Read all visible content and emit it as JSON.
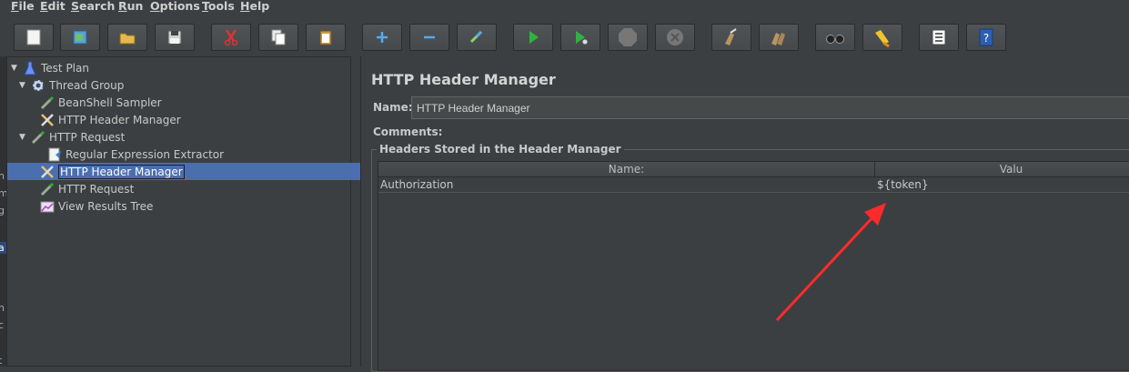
{
  "menu": {
    "items": [
      {
        "u": "F",
        "rest": "ile"
      },
      {
        "u": "E",
        "rest": "dit"
      },
      {
        "u": "S",
        "rest": "earch"
      },
      {
        "u": "R",
        "rest": "un"
      },
      {
        "u": "O",
        "rest": "ptions"
      },
      {
        "u": "T",
        "rest": "ools"
      },
      {
        "u": "H",
        "rest": "elp"
      }
    ]
  },
  "toolbar": {
    "buttons": [
      "new-icon",
      "templates-icon",
      "open-icon",
      "save-icon",
      "cut-icon",
      "copy-icon",
      "paste-icon",
      "expand-icon",
      "collapse-icon",
      "toggle-icon",
      "start-icon",
      "start-no-pause-icon",
      "stop-icon",
      "shutdown-icon",
      "clear-icon",
      "clear-all-icon",
      "search-icon",
      "reset-search-icon",
      "function-helper-icon",
      "help-icon"
    ]
  },
  "edge_chars": [
    "n",
    "m",
    "g",
    "a",
    "n",
    "c",
    "t"
  ],
  "tree": {
    "nodes": [
      {
        "label": "Test Plan",
        "icon": "test-plan-icon",
        "toggle": "▼"
      },
      {
        "label": "Thread Group",
        "icon": "thread-group-icon",
        "toggle": "▼"
      },
      {
        "label": "BeanShell Sampler",
        "icon": "sampler-icon",
        "toggle": ""
      },
      {
        "label": "HTTP Header Manager",
        "icon": "config-wrench-icon",
        "toggle": ""
      },
      {
        "label": "HTTP Request",
        "icon": "sampler-icon",
        "toggle": "▼"
      },
      {
        "label": "Regular Expression Extractor",
        "icon": "extractor-icon",
        "toggle": ""
      },
      {
        "label": "HTTP Header Manager",
        "icon": "config-wrench-icon",
        "toggle": ""
      },
      {
        "label": "HTTP Request",
        "icon": "sampler-icon",
        "toggle": ""
      },
      {
        "label": "View Results Tree",
        "icon": "listener-icon",
        "toggle": ""
      }
    ],
    "selected_index": 6
  },
  "panel": {
    "title": "HTTP Header Manager",
    "name_label": "Name:",
    "name_value": "HTTP Header Manager",
    "comments_label": "Comments:",
    "group_title": "Headers Stored in the Header Manager",
    "columns": [
      "Name:",
      "Valu"
    ],
    "rows": [
      {
        "name": "Authorization",
        "value": "${token}"
      }
    ]
  },
  "colors": {
    "background": "#3c3f41",
    "selection": "#4b6eaf",
    "annotation_arrow": "#ff2a2a"
  }
}
